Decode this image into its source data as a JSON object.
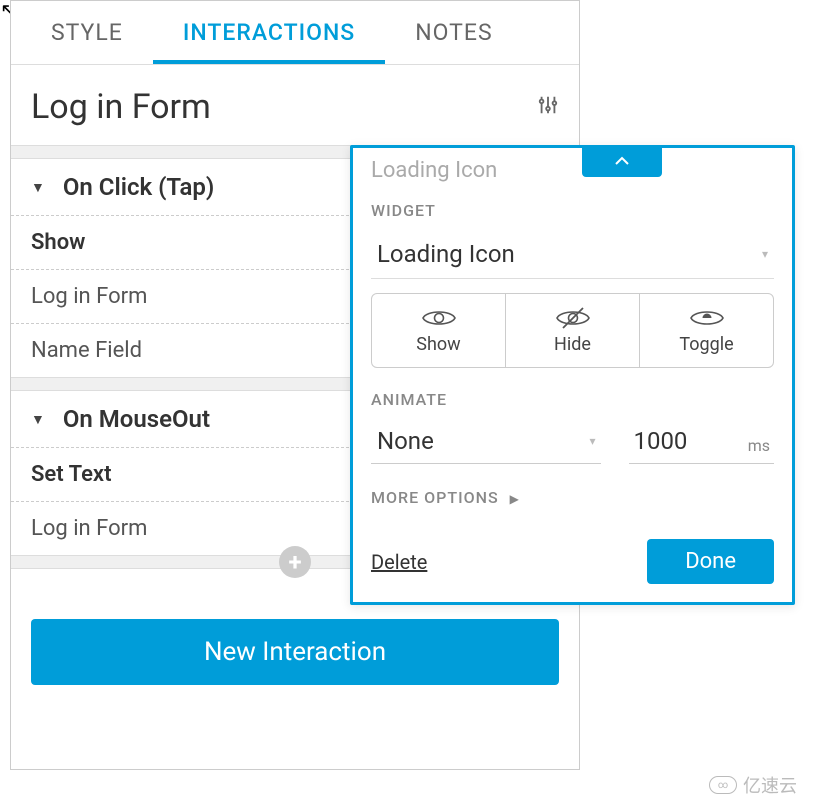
{
  "tabs": {
    "style": "STYLE",
    "interactions": "INTERACTIONS",
    "notes": "NOTES"
  },
  "panel": {
    "title": "Log in Form"
  },
  "events": [
    {
      "trigger": "On Click (Tap)",
      "action": "Show",
      "targets": [
        "Log in Form",
        "Name Field"
      ]
    },
    {
      "trigger": "On MouseOut",
      "action": "Set Text",
      "targets": [
        "Log in Form"
      ]
    }
  ],
  "new_interaction_label": "New Interaction",
  "popup": {
    "header_hint": "Loading Icon",
    "widget_label": "WIDGET",
    "widget_value": "Loading Icon",
    "visibility": {
      "show": "Show",
      "hide": "Hide",
      "toggle": "Toggle"
    },
    "animate_label": "ANIMATE",
    "animate_value": "None",
    "duration_value": "1000",
    "duration_unit": "ms",
    "more_options": "MORE OPTIONS",
    "delete": "Delete",
    "done": "Done"
  },
  "watermark": "亿速云"
}
